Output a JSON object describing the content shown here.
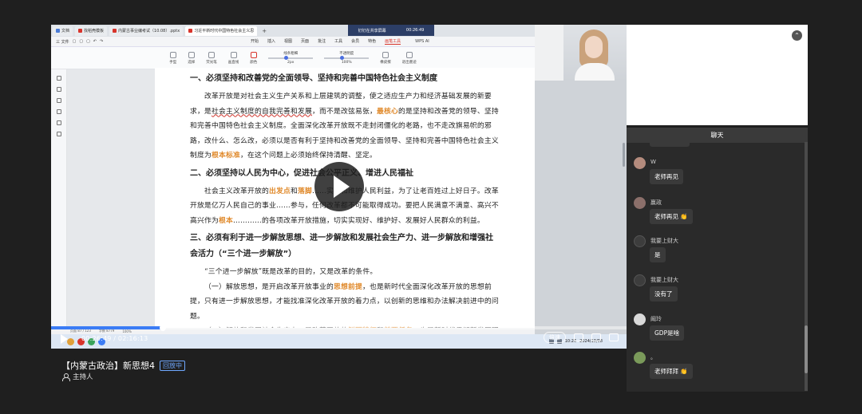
{
  "browser": {
    "tabs": [
      {
        "label": "文档",
        "color": "#4a7bd6"
      },
      {
        "label": "找稻壳模板",
        "color": "#d8342b"
      },
      {
        "label": "内蒙古事业编考试（10.08）.pptx",
        "color": "#d8342b"
      },
      {
        "label": "习近平新时代中国特色社会主义思",
        "color": "#d8342b",
        "active": true
      }
    ],
    "new_tab": "+"
  },
  "meeting": {
    "title": "钉钉在共享屏幕",
    "time": "00:26:49"
  },
  "ribbon": {
    "left_items": [
      "三 文件",
      "▢",
      "▢",
      "▢",
      "↶",
      "↷"
    ],
    "menu": [
      "开始",
      "插入",
      "视图",
      "页面",
      "批注",
      "工具",
      "会员",
      "特色",
      "画笔工具"
    ],
    "selected_menu": "画笔工具",
    "wps_ai": "WPS AI"
  },
  "pen_toolbar": {
    "items": [
      "手型",
      "选择",
      "荧光笔",
      "画直线",
      "颜色",
      "线条粗细",
      "不透明度",
      "2px",
      "100%",
      "橡皮擦",
      "退出墨迹"
    ]
  },
  "document": {
    "heading1": "一、必须坚持和改善党的全面领导、坚持和完善中国特色社会主义制度",
    "para1_parts": [
      {
        "t": "改革开放是对社会主义生产关系和上层建筑的调整，使之适应生产力和经济基础发展的新要求，是"
      },
      {
        "t": "社会主义制度的自我完善和发展",
        "style": "wave"
      },
      {
        "t": "，而不是改弦易张，"
      },
      {
        "t": "最核心",
        "style": "em"
      },
      {
        "t": "的是坚持和改善党的领导、坚持和完善中国特色社会主义制度。全面深化改革开放既不走封闭僵化的老路，也不走改旗易帜的邪路，改什么、怎么改，必须以是否有利于坚持和改善党的全面领导、坚持和完善中国特色社会主义制度为"
      },
      {
        "t": "根本标准",
        "style": "em"
      },
      {
        "t": "，在这个问题上必须始终保持清醒、坚定。"
      }
    ],
    "heading2": "二、必须坚持以人民为中心，促进社会公平正义、增进人民福祉",
    "para2_parts": [
      {
        "t": "社会主义改革开放的"
      },
      {
        "t": "出发点",
        "style": "em"
      },
      {
        "t": "和"
      },
      {
        "t": "落脚",
        "style": "em"
      },
      {
        "t": "……实现和维护人民利益，为了让老百姓过上好日子。改革开放是亿万人民自己的事业……参与，任何改革都不可能取得成功。要把人民满意不满意、高兴不高兴作为"
      },
      {
        "t": "根本",
        "style": "em"
      },
      {
        "t": "…………的各项改革开放措施，切实实现好、维护好、发展好人民群众的利益。"
      }
    ],
    "heading3": "三、必须有利于进一步解放思想、进一步解放和发展社会生产力、进一步解放和增强社会活力（“三个进一步解放”）",
    "para3": "“三个进一步解放”既是改革的目的，又是改革的条件。",
    "para4_parts": [
      {
        "t": "（一）解放思想，是开启改革开放事业的"
      },
      {
        "t": "思想前提",
        "style": "em"
      },
      {
        "t": "，也是新时代全面深化改革开放的思想前提，只有进一步解放思想，才能找准深化改革开放的着力点，以创新的思维和办法解决前进中的问题。"
      }
    ],
    "para5_parts": [
      {
        "t": "（二）解放和发展社会生产力，是改革开放的"
      },
      {
        "t": "鲜明特征",
        "style": "em"
      },
      {
        "t": "和"
      },
      {
        "t": "首要任务",
        "style": "em"
      },
      {
        "t": "，也是新时代贯彻新发展理念、构建新发展格局、推动高质量发展的必然要求，只有进一步解放和发展社会生产力，紧紧围绕全面"
      }
    ]
  },
  "statusbar": {
    "page": "页面 87 / 123",
    "words": "字数 8779",
    "zoom": "100%"
  },
  "player": {
    "time": "00:26:49 / 02:16:13",
    "progress": 0.194,
    "speed": "倍速"
  },
  "taskbar": {
    "clock": "10:26",
    "date": "2024/10/08"
  },
  "live": {
    "title": "【内蒙古政治】新思想4",
    "badge": "回放中",
    "host": "主持人"
  },
  "chat": {
    "header": "聊天",
    "collapse": "⌃",
    "messages": [
      {
        "name": "W",
        "text": "老师再见",
        "avatar": "#b48b7d"
      },
      {
        "name": "赢政",
        "text": "老师再见 👏",
        "avatar": "#8b6f6a"
      },
      {
        "name": "我要上财大",
        "text": "是",
        "avatar": "#3d3d3d"
      },
      {
        "name": "我要上财大",
        "text": "没有了",
        "avatar": "#3d3d3d"
      },
      {
        "name": "阚玲",
        "text": "GDP是啥",
        "avatar": "#d9d9d9"
      },
      {
        "name": "。",
        "text": "老师拜拜 👏",
        "avatar": "#7a9a5a"
      }
    ]
  }
}
